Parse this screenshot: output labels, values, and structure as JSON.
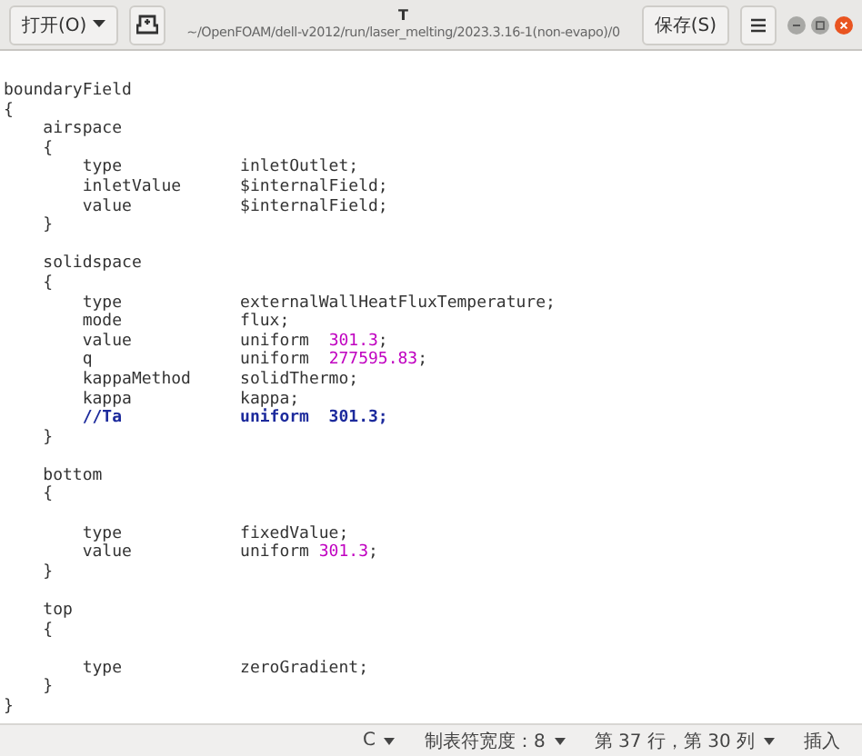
{
  "header": {
    "open_button": "打开(O)",
    "title": "T",
    "subtitle": "~/OpenFOAM/dell-v2012/run/laser_melting/2023.3.16-1(non-evapo)/0",
    "save_button": "保存(S)"
  },
  "editor": {
    "blocks": [
      {
        "lines": [
          {
            "segments": [
              {
                "kind": "text",
                "text": "boundaryField"
              }
            ]
          },
          {
            "segments": [
              {
                "kind": "text",
                "text": "{"
              }
            ]
          },
          {
            "segments": [
              {
                "kind": "text",
                "text": "    airspace"
              }
            ]
          },
          {
            "segments": [
              {
                "kind": "text",
                "text": "    {"
              }
            ]
          },
          {
            "segments": [
              {
                "kind": "text",
                "text": "        type            inletOutlet;"
              }
            ]
          },
          {
            "segments": [
              {
                "kind": "text",
                "text": "        inletValue      $internalField;"
              }
            ]
          },
          {
            "segments": [
              {
                "kind": "text",
                "text": "        value           $internalField;"
              }
            ]
          },
          {
            "segments": [
              {
                "kind": "text",
                "text": "    }"
              }
            ]
          }
        ]
      },
      {
        "lines": [
          {
            "segments": [
              {
                "kind": "text",
                "text": "    solidspace"
              }
            ]
          },
          {
            "segments": [
              {
                "kind": "text",
                "text": "    {"
              }
            ]
          },
          {
            "segments": [
              {
                "kind": "text",
                "text": "        type            externalWallHeatFluxTemperature;"
              }
            ]
          },
          {
            "segments": [
              {
                "kind": "text",
                "text": "        mode            flux;"
              }
            ]
          },
          {
            "segments": [
              {
                "kind": "text",
                "text": "        value           uniform  "
              },
              {
                "kind": "number",
                "text": "301.3"
              },
              {
                "kind": "text",
                "text": ";"
              }
            ]
          },
          {
            "segments": [
              {
                "kind": "text",
                "text": "        q               uniform  "
              },
              {
                "kind": "number",
                "text": "277595.83"
              },
              {
                "kind": "text",
                "text": ";"
              }
            ]
          },
          {
            "segments": [
              {
                "kind": "text",
                "text": "        kappaMethod     solidThermo;"
              }
            ]
          },
          {
            "segments": [
              {
                "kind": "text",
                "text": "        kappa           kappa;"
              }
            ]
          },
          {
            "segments": [
              {
                "kind": "comment",
                "text": "        //Ta            uniform  301.3;"
              }
            ]
          },
          {
            "segments": [
              {
                "kind": "text",
                "text": "    }"
              }
            ]
          }
        ]
      },
      {
        "lines": [
          {
            "segments": [
              {
                "kind": "text",
                "text": "    bottom"
              }
            ]
          },
          {
            "segments": [
              {
                "kind": "text",
                "text": "    {"
              }
            ]
          }
        ]
      },
      {
        "lines": [
          {
            "segments": [
              {
                "kind": "text",
                "text": "        type            fixedValue;"
              }
            ]
          },
          {
            "segments": [
              {
                "kind": "text",
                "text": "        value           uniform "
              },
              {
                "kind": "number",
                "text": "301.3"
              },
              {
                "kind": "text",
                "text": ";"
              }
            ]
          },
          {
            "segments": [
              {
                "kind": "text",
                "text": "    }"
              }
            ]
          }
        ]
      },
      {
        "lines": [
          {
            "segments": [
              {
                "kind": "text",
                "text": "    top"
              }
            ]
          },
          {
            "segments": [
              {
                "kind": "text",
                "text": "    {"
              }
            ]
          }
        ]
      },
      {
        "lines": [
          {
            "segments": [
              {
                "kind": "text",
                "text": "        type            zeroGradient;"
              }
            ]
          },
          {
            "segments": [
              {
                "kind": "text",
                "text": "    }"
              }
            ]
          },
          {
            "segments": [
              {
                "kind": "text",
                "text": "}"
              }
            ]
          }
        ]
      }
    ]
  },
  "status_bar": {
    "language": "C",
    "tab_width": "制表符宽度：8",
    "position": "第 37 行，第 30 列",
    "mode": "插入"
  }
}
